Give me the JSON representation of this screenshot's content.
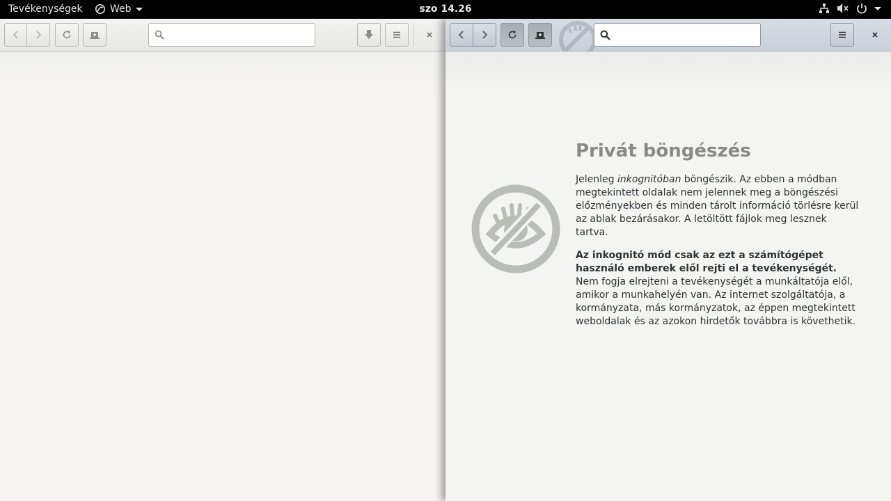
{
  "topbar": {
    "activities": "Tevékenységek",
    "app_name": "Web",
    "clock": "szo 14.26",
    "status_icons": [
      "network-icon",
      "volume-muted-icon",
      "power-icon"
    ]
  },
  "left_window": {
    "search_placeholder": "",
    "search_value": ""
  },
  "right_window": {
    "search_placeholder": "",
    "search_value": "",
    "private": {
      "title": "Privát böngészés",
      "p1_before": "Jelenleg ",
      "p1_em": "inkognitóban",
      "p1_after": " böngészik. Az ebben a módban megtekintett oldalak nem jelennek meg a böngészési előzményekben és minden tárolt információ törlésre kerül az ablak bezárásakor. A letöltött fájlok meg lesznek tartva.",
      "p2_bold": "Az inkognitó mód csak az ezt a számítógépet használó emberek elől rejti el a tevékenységét.",
      "p2_rest": " Nem fogja elrejteni a tevékenységét a munkáltatója elől, amikor a munkahelyén van. Az internet szolgáltatója, a kormányzata, más kormányzatok, az éppen megtekintett weboldalak és az azokon hirdetők továbbra is követhetik."
    }
  },
  "colors": {
    "topbar_bg": "#000000",
    "incognito_header": "#c9d0d8",
    "icon_gray": "#babdb6"
  }
}
